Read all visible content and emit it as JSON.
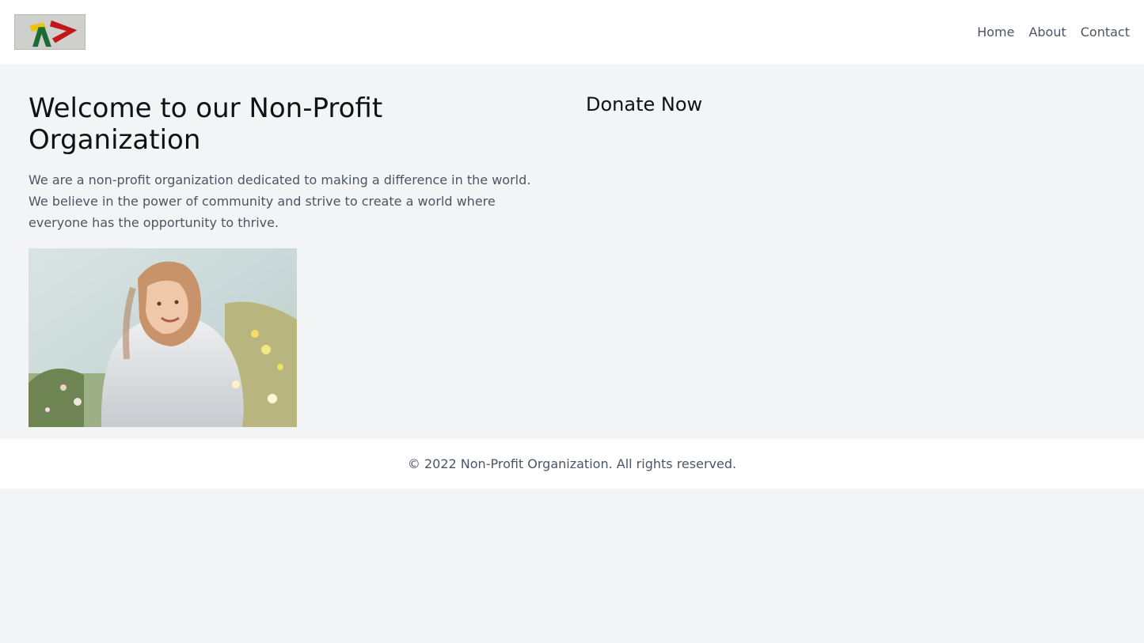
{
  "header": {
    "logo_alt": "Organization logo",
    "nav": {
      "home": "Home",
      "about": "About",
      "contact": "Contact"
    }
  },
  "main": {
    "title": "Welcome to our Non-Profit Organization",
    "intro": "We are a non-profit organization dedicated to making a difference in the world. We believe in the power of community and strive to create a world where everyone has the opportunity to thrive.",
    "photo_alt": "Smiling woman sitting among wildflowers",
    "donate_title": "Donate Now"
  },
  "footer": {
    "copyright": "© 2022 Non-Profit Organization. All rights reserved."
  },
  "colors": {
    "page_background": "#f3f4f6",
    "header_background": "#ffffff",
    "text_primary": "#111111",
    "text_secondary": "#4b5563",
    "logo_green": "#1e6b35",
    "logo_yellow": "#e9c50d",
    "logo_red": "#c4171b"
  }
}
